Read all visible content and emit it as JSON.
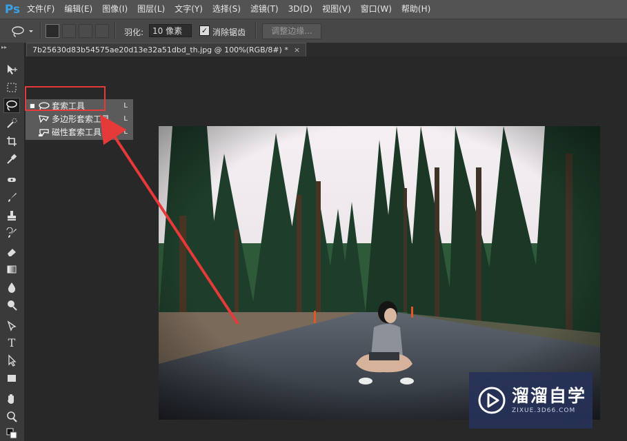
{
  "app": {
    "logo": "Ps"
  },
  "menu": [
    "文件(F)",
    "编辑(E)",
    "图像(I)",
    "图层(L)",
    "文字(Y)",
    "选择(S)",
    "滤镜(T)",
    "3D(D)",
    "视图(V)",
    "窗口(W)",
    "帮助(H)"
  ],
  "options": {
    "feather_label": "羽化:",
    "feather_value": "10 像素",
    "antialias_label": "消除锯齿",
    "antialias_checked": true,
    "refine_edge": "调整边缘..."
  },
  "document": {
    "tab_title": "7b25630d83b54575ae20d13e32a51dbd_th.jpg @ 100%(RGB/8#) *",
    "close": "×"
  },
  "flyout": {
    "items": [
      {
        "label": "套索工具",
        "shortcut": "L",
        "icon": "lasso-icon",
        "selected": true
      },
      {
        "label": "多边形套索工具",
        "shortcut": "L",
        "icon": "polygon-lasso-icon",
        "selected": false
      },
      {
        "label": "磁性套索工具",
        "shortcut": "L",
        "icon": "magnetic-lasso-icon",
        "selected": false
      }
    ]
  },
  "toolbar": {
    "tools": [
      "move-tool",
      "marquee-tool",
      "lasso-tool",
      "quick-select-tool",
      "crop-tool",
      "eyedropper-tool",
      "healing-tool",
      "brush-tool",
      "stamp-tool",
      "history-brush-tool",
      "eraser-tool",
      "gradient-tool",
      "blur-tool",
      "dodge-tool",
      "pen-tool",
      "type-tool",
      "path-select-tool",
      "shape-tool",
      "hand-tool",
      "zoom-tool"
    ],
    "type_tool_glyph": "T"
  },
  "watermark": {
    "name": "溜溜自学",
    "url": "ZIXUE.3D66.COM"
  },
  "colors": {
    "annotation": "#e63a3a",
    "ps_blue": "#3aa0e8",
    "watermark_bg": "#263258"
  }
}
